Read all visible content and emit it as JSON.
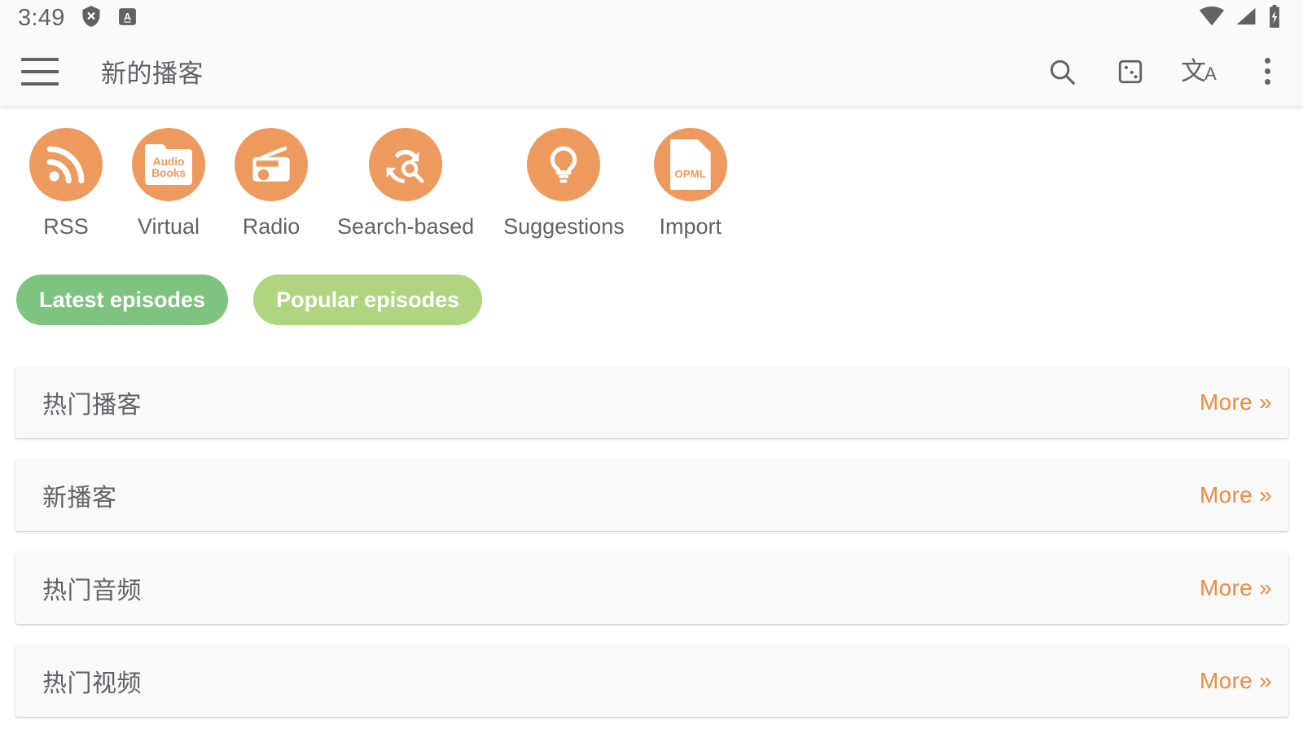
{
  "status_bar": {
    "clock": "3:49",
    "left_icons": [
      {
        "name": "shield-x-icon"
      },
      {
        "name": "app-badge-a-icon"
      }
    ],
    "right_icons": [
      {
        "name": "wifi-icon"
      },
      {
        "name": "cellular-signal-icon"
      },
      {
        "name": "battery-charging-icon"
      }
    ]
  },
  "app_bar": {
    "menu_icon": "hamburger-menu-icon",
    "title": "新的播客",
    "actions": [
      {
        "name": "search-icon",
        "label": "Search"
      },
      {
        "name": "dice-icon",
        "label": "Random"
      },
      {
        "name": "translate-icon",
        "label": "文",
        "sub": "A"
      },
      {
        "name": "overflow-menu-icon",
        "label": "More options"
      }
    ]
  },
  "categories": [
    {
      "label": "RSS",
      "icon": "rss-icon"
    },
    {
      "label": "Virtual",
      "icon": "audio-books-folder-icon",
      "folder_line1": "Audio",
      "folder_line2": "Books"
    },
    {
      "label": "Radio",
      "icon": "radio-icon"
    },
    {
      "label": "Search-based",
      "icon": "search-refresh-icon"
    },
    {
      "label": "Suggestions",
      "icon": "lightbulb-icon"
    },
    {
      "label": "Import",
      "icon": "opml-document-icon",
      "doc_label": "OPML"
    }
  ],
  "chips": [
    {
      "label": "Latest episodes",
      "color": "#7dc57f",
      "selected": true
    },
    {
      "label": "Popular episodes",
      "color": "#afd57e",
      "selected": false
    }
  ],
  "cards": [
    {
      "title": "热门播客",
      "more": "More »"
    },
    {
      "title": "新播客",
      "more": "More »"
    },
    {
      "title": "热门音频",
      "more": "More »"
    },
    {
      "title": "热门视频",
      "more": "More »"
    }
  ],
  "colors": {
    "accent_orange": "#ee9a5e",
    "link_orange": "#ee8c3f",
    "text_grey": "#5f6368",
    "appbar_bg": "#fafafa",
    "card_bg": "#f9f9f9"
  }
}
